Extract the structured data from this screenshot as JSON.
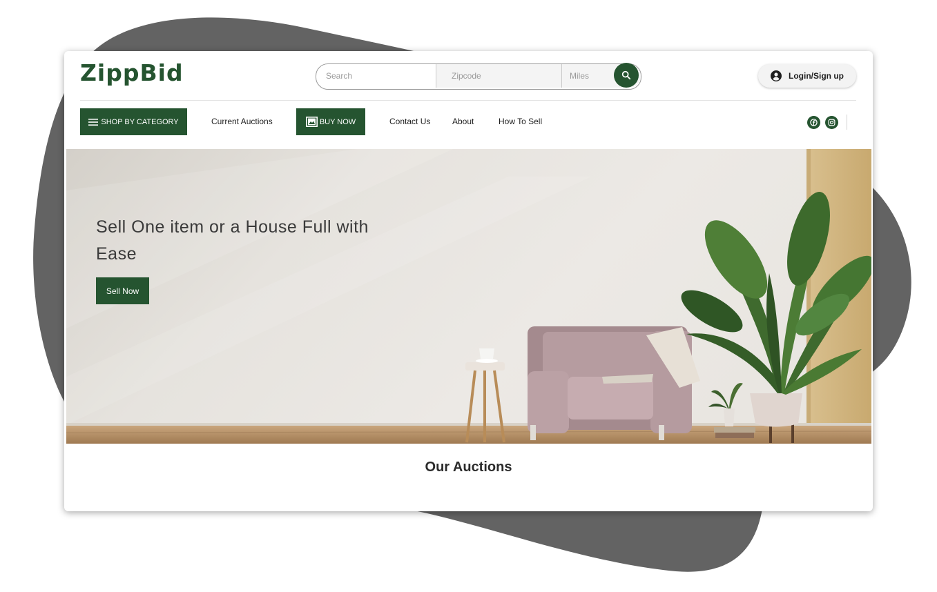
{
  "brand": {
    "logo": "ZippBid",
    "accent_color": "#255430"
  },
  "search": {
    "search_placeholder": "Search",
    "zipcode_placeholder": "Zipcode",
    "miles_placeholder": "Miles",
    "button_icon": "search-icon"
  },
  "account": {
    "login_label": "Login/Sign up",
    "icon": "user-circle-icon"
  },
  "nav": {
    "shop_by_category": "SHOP BY CATEGORY",
    "current_auctions": "Current Auctions",
    "buy_now": "BUY NOW",
    "contact_us": "Contact Us",
    "about": "About",
    "how_to_sell": "How To Sell",
    "social": [
      "facebook-icon",
      "instagram-icon"
    ]
  },
  "hero": {
    "heading": "Sell One item or a House Full with Ease",
    "cta": "Sell Now"
  },
  "auctions": {
    "title": "Our Auctions"
  }
}
